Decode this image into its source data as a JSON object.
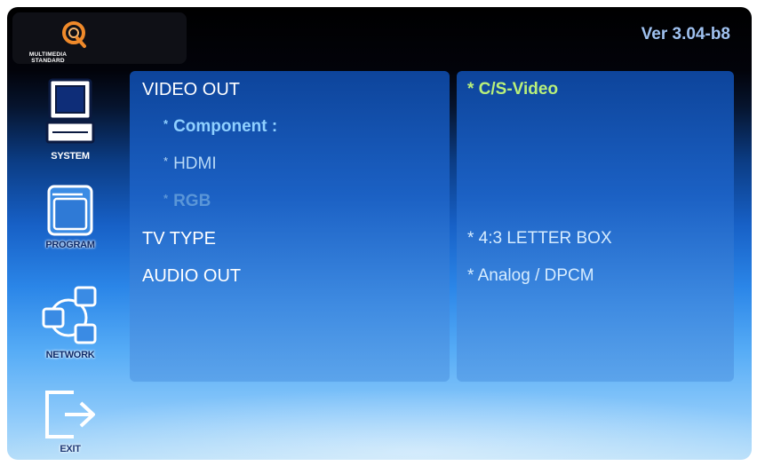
{
  "header": {
    "logo_text": "MULTIMEDIA STANDARD",
    "version": "Ver 3.04-b8"
  },
  "sidebar": {
    "items": [
      {
        "label": "SYSTEM",
        "icon": "monitor-icon",
        "active": true
      },
      {
        "label": "PROGRAM",
        "icon": "window-icon",
        "active": false
      },
      {
        "label": "NETWORK",
        "icon": "network-icon",
        "active": false
      },
      {
        "label": "EXIT",
        "icon": "exit-arrow-icon",
        "active": false
      }
    ]
  },
  "settings": {
    "video_out": {
      "label": "VIDEO OUT",
      "value": "* C/S-Video",
      "options": [
        {
          "label": "Component :",
          "star": "*"
        },
        {
          "label": "HDMI",
          "star": "*"
        },
        {
          "label": "RGB",
          "star": "*"
        }
      ]
    },
    "tv_type": {
      "label": "TV TYPE",
      "value": "* 4:3 LETTER BOX"
    },
    "audio_out": {
      "label": "AUDIO OUT",
      "value": "* Analog / DPCM"
    }
  },
  "colors": {
    "value_highlight": "#b9f07a",
    "value_normal": "#d6ecff",
    "option_highlight": "#8fd0ff",
    "option_dim": "#9cc8f0"
  }
}
